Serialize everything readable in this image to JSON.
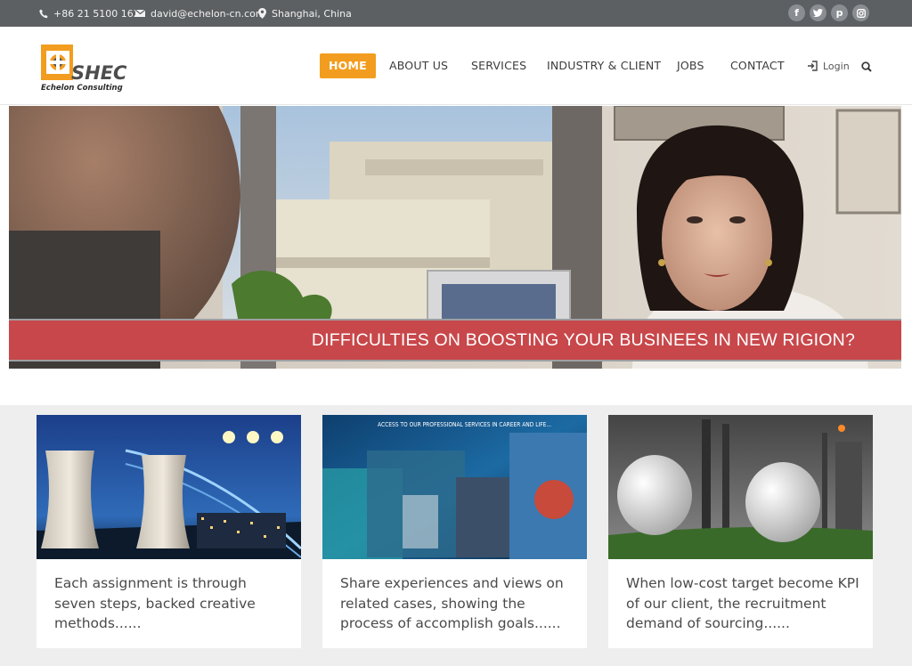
{
  "topbar": {
    "phone": "+86 21 5100 1620",
    "email": "david@echelon-cn.com",
    "location": "Shanghai, China",
    "social": [
      "f",
      "t",
      "p",
      "i"
    ]
  },
  "logo": {
    "mark": "SHEC",
    "tagline": "Echelon Consulting"
  },
  "nav": {
    "items": [
      "HOME",
      "ABOUT US",
      "SERVICES",
      "INDUSTRY & CLIENT",
      "JOBS",
      "CONTACT"
    ],
    "login": "Login"
  },
  "hero": {
    "banner": "DIFFICULTIES ON BOOSTING YOUR BUSINEES IN NEW RIGION?"
  },
  "cards": [
    {
      "text": "Each assignment is through seven steps, backed creative methods......"
    },
    {
      "text": "Share experiences and views on related cases, showing the process of accomplish goals......",
      "image_caption": "ACCESS TO OUR PROFESSIONAL SERVICES IN CAREER AND LIFE..."
    },
    {
      "text": "When low-cost target become KPI of our client, the recruitment demand of sourcing......"
    }
  ],
  "colors": {
    "topbar": "#5d6063",
    "accent": "#f29d1f",
    "banner": "#c8474a",
    "card_bg": "#eeeeee"
  }
}
